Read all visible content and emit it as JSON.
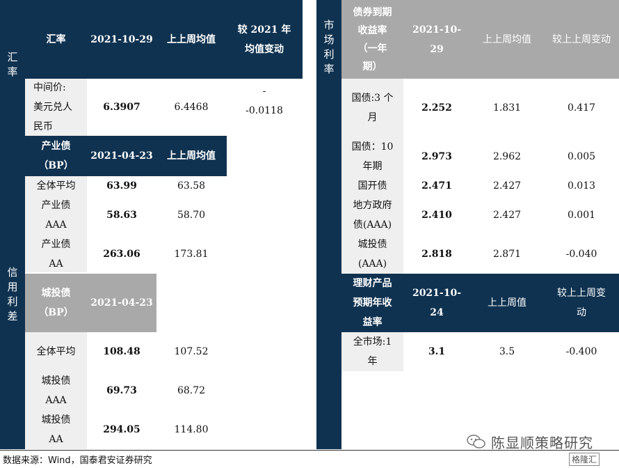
{
  "fx": {
    "section_label": "汇率",
    "header": [
      "汇率",
      "2021-10-29",
      "上上周均值",
      "较 2021 年\n均值变动"
    ],
    "row": {
      "label": "中间价:\n美元兑人\n民币",
      "value": "6.3907",
      "prev": "6.4468",
      "change": "-\n-0.0118"
    }
  },
  "credit": {
    "section_label": "信用利差",
    "industrial_header": [
      "产业债\n（BP）",
      "2021-04-23",
      "上上周均值"
    ],
    "industrial_rows": [
      {
        "label": "全体平均",
        "value": "63.99",
        "prev": "63.58"
      },
      {
        "label": "产业债\nAAA",
        "value": "58.63",
        "prev": "58.70"
      },
      {
        "label": "产业债\nAA",
        "value": "263.06",
        "prev": "173.81"
      }
    ],
    "urban_header": [
      "城投债\n（BP）",
      "2021-04-23"
    ],
    "urban_rows": [
      {
        "label": "全体平均",
        "value": "108.48",
        "prev": "107.52"
      },
      {
        "label": "城投债\nAAA",
        "value": "69.73",
        "prev": "68.72"
      },
      {
        "label": "城投债\nAA",
        "value": "294.05",
        "prev": "114.80"
      }
    ]
  },
  "market": {
    "section_label": "市场利率",
    "bond_header": [
      "债券到期\n收益率\n（一年\n期）",
      "2021-10-\n29",
      "上上周均值",
      "较上上周变动"
    ],
    "bond_rows": [
      {
        "label": "国债:3 个\n月",
        "value": "2.252",
        "prev": "1.831",
        "change": "0.417"
      },
      {
        "label": "国债：10\n年期",
        "value": "2.973",
        "prev": "2.962",
        "change": "0.005"
      },
      {
        "label": "国开债",
        "value": "2.471",
        "prev": "2.427",
        "change": "0.013"
      },
      {
        "label": "地方政府\n债(AAA)",
        "value": "2.410",
        "prev": "2.427",
        "change": "0.001"
      },
      {
        "label": "城投债\n(AAA)",
        "value": "2.818",
        "prev": "2.871",
        "change": "-0.040"
      }
    ],
    "wealth_header": [
      "理财产品\n预期年收\n益率",
      "2021-10-\n24",
      "上上周值",
      "较上上周变\n动"
    ],
    "wealth_rows": [
      {
        "label": "全市场:1\n年",
        "value": "3.1",
        "prev": "3.5",
        "change": "-0.400"
      }
    ]
  },
  "footer": {
    "source": "数据来源：Wind，国泰君安证券研究"
  },
  "watermark": {
    "text": "陈显顺策略研究",
    "logo": "格隆汇"
  },
  "colors": {
    "navy": "#0f3250",
    "gray": "#a9a9a9",
    "light_gray": "#efefef"
  }
}
